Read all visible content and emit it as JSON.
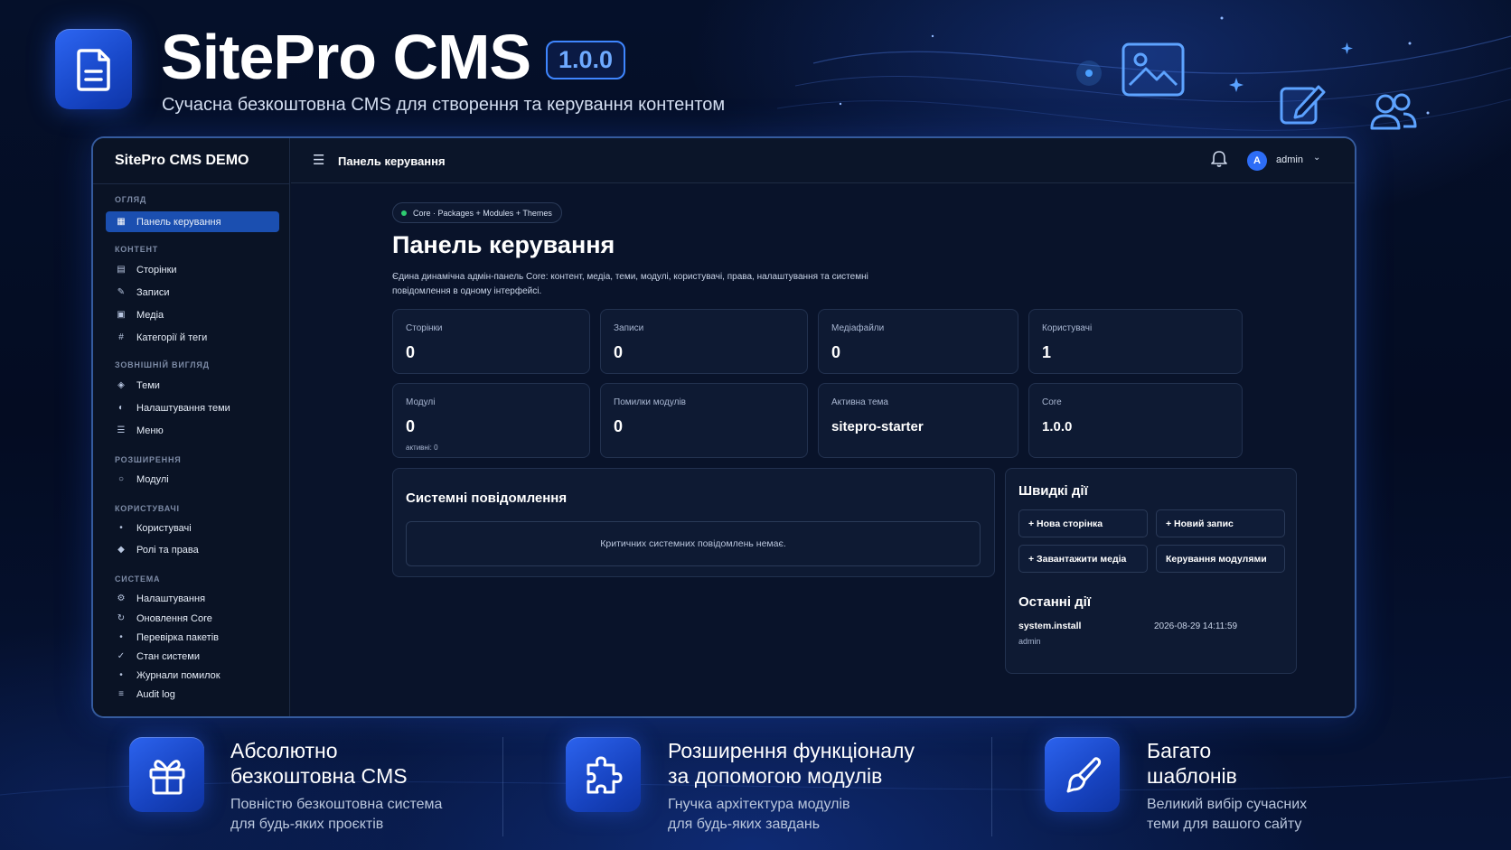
{
  "header": {
    "title": "SitePro CMS",
    "version": "1.0.0",
    "subtitle": "Сучасна безкоштовна CMS для створення та керування контентом"
  },
  "colors": {
    "accent": "#2d6df6",
    "background": "#05102a",
    "active_nav": "#1b4fb0",
    "status_dot": "#2ecc71"
  },
  "sidebar": {
    "title": "SitePro CMS DEMO",
    "sections": [
      {
        "label": "ОГЛЯД",
        "items": [
          {
            "label": "Панель керування",
            "icon": "dashboard-icon",
            "active": true
          }
        ]
      },
      {
        "label": "КОНТЕНТ",
        "items": [
          {
            "label": "Сторінки",
            "icon": "pages-icon"
          },
          {
            "label": "Записи",
            "icon": "pencil-icon"
          },
          {
            "label": "Медіа",
            "icon": "media-icon"
          },
          {
            "label": "Категорії й теги",
            "icon": "hash-icon"
          }
        ]
      },
      {
        "label": "ЗОВНІШНІЙ ВИГЛЯД",
        "items": [
          {
            "label": "Теми",
            "icon": "diamond-icon"
          },
          {
            "label": "Налаштування теми",
            "icon": "contrast-icon"
          },
          {
            "label": "Меню",
            "icon": "list-icon"
          }
        ]
      },
      {
        "label": "РОЗШИРЕННЯ",
        "items": [
          {
            "label": "Модулі",
            "icon": "circle-icon"
          }
        ]
      },
      {
        "label": "КОРИСТУВАЧІ",
        "items": [
          {
            "label": "Користувачі",
            "icon": "dot-icon"
          },
          {
            "label": "Ролі та права",
            "icon": "diamond-icon"
          }
        ]
      },
      {
        "label": "СИСТЕМА",
        "items": [
          {
            "label": "Налаштування",
            "icon": "gear-icon"
          },
          {
            "label": "Оновлення Core",
            "icon": "refresh-icon"
          },
          {
            "label": "Перевірка пакетів",
            "icon": "dot-icon"
          },
          {
            "label": "Стан системи",
            "icon": "check-icon"
          },
          {
            "label": "Журнали помилок",
            "icon": "dot-icon"
          },
          {
            "label": "Audit log",
            "icon": "list-icon"
          }
        ]
      }
    ]
  },
  "topbar": {
    "title": "Панель керування",
    "user_initial": "A",
    "user_name": "admin"
  },
  "main": {
    "pill": "Core · Packages + Modules + Themes",
    "title": "Панель керування",
    "description": "Єдина динамічна адмін-панель Core: контент, медіа, теми, модулі, користувачі, права, налаштування та системні повідомлення в одному інтерфейсі.",
    "stats": [
      {
        "label": "Сторінки",
        "value": "0"
      },
      {
        "label": "Записи",
        "value": "0"
      },
      {
        "label": "Медіафайли",
        "value": "0"
      },
      {
        "label": "Користувачі",
        "value": "1"
      },
      {
        "label": "Модулі",
        "value": "0",
        "sub": "активні: 0"
      },
      {
        "label": "Помилки модулів",
        "value": "0"
      },
      {
        "label": "Активна тема",
        "value": "sitepro-starter"
      },
      {
        "label": "Core",
        "value": "1.0.0"
      }
    ],
    "system_messages": {
      "title": "Системні повідомлення",
      "empty": "Критичних системних повідомлень немає."
    },
    "quick_actions": {
      "title": "Швидкі дії",
      "buttons": [
        "+ Нова сторінка",
        "+ Новий запис",
        "+ Завантажити медіа",
        "Керування модулями"
      ]
    },
    "recent": {
      "title": "Останні дії",
      "items": [
        {
          "action": "system.install",
          "user": "admin",
          "time": "2026-08-29 14:11:59"
        }
      ]
    }
  },
  "features": [
    {
      "icon": "gift-icon",
      "title_line1": "Абсолютно",
      "title_line2": "безкоштовна CMS",
      "desc_line1": "Повністю безкоштовна система",
      "desc_line2": "для будь-яких проєктів"
    },
    {
      "icon": "puzzle-icon",
      "title_line1": "Розширення функціоналу",
      "title_line2": "за допомогою модулів",
      "desc_line1": "Гнучка архітектура модулів",
      "desc_line2": "для будь-яких завдань"
    },
    {
      "icon": "brush-icon",
      "title_line1": "Багато",
      "title_line2": "шаблонів",
      "desc_line1": "Великий вибір сучасних",
      "desc_line2": "теми для вашого сайту"
    }
  ]
}
